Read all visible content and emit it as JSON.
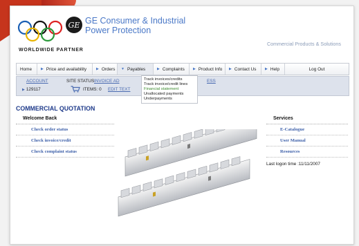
{
  "header": {
    "brand_line1": "GE Consumer & Industrial",
    "brand_line2": "Power Protection",
    "tagline": "Commercial Products & Solutions",
    "partner_label": "WORLDWIDE PARTNER",
    "ge_mark": "GE"
  },
  "nav": {
    "items": [
      {
        "label": "Home",
        "arrow": ""
      },
      {
        "label": "Price and availability",
        "arrow": "▶"
      },
      {
        "label": "Orders",
        "arrow": "▶"
      },
      {
        "label": "Payables",
        "arrow": "▼"
      },
      {
        "label": "Complaints",
        "arrow": "▶"
      },
      {
        "label": "Product Info",
        "arrow": "▶"
      },
      {
        "label": "Contact Us",
        "arrow": "▶"
      },
      {
        "label": "Help",
        "arrow": "▶"
      },
      {
        "label": "Log Out",
        "arrow": ""
      }
    ],
    "payables_menu": [
      "Track invoices/credits",
      "Track invoice/credit lines",
      "Financial statement",
      "Unallocated payments",
      "Underpayments"
    ]
  },
  "subbar": {
    "account_label": "ACCOUNT",
    "account_number": "129117",
    "site_status_label": "SITE STATUS",
    "invoice_link": "INVOICE AD",
    "trailing_link": "ESS",
    "items_label": "ITEMS: 0",
    "edit_link": "EDIT TEXT"
  },
  "main": {
    "title": "COMMERCIAL QUOTATION",
    "left_panel": {
      "heading": "Welcome Back",
      "links": [
        "Check order status",
        "Check invoice/credit",
        "Check complaint status"
      ]
    },
    "right_panel": {
      "heading": "Services",
      "links": [
        "E-Catalogue",
        "User Manual",
        "Resources"
      ]
    },
    "last_logon": "Last logon time :11/11/2007"
  },
  "colors": {
    "brand_blue": "#4a78c7",
    "title_navy": "#1e3a8a",
    "corner_red": "#c6341c",
    "link_blue": "#3b5ea8"
  }
}
